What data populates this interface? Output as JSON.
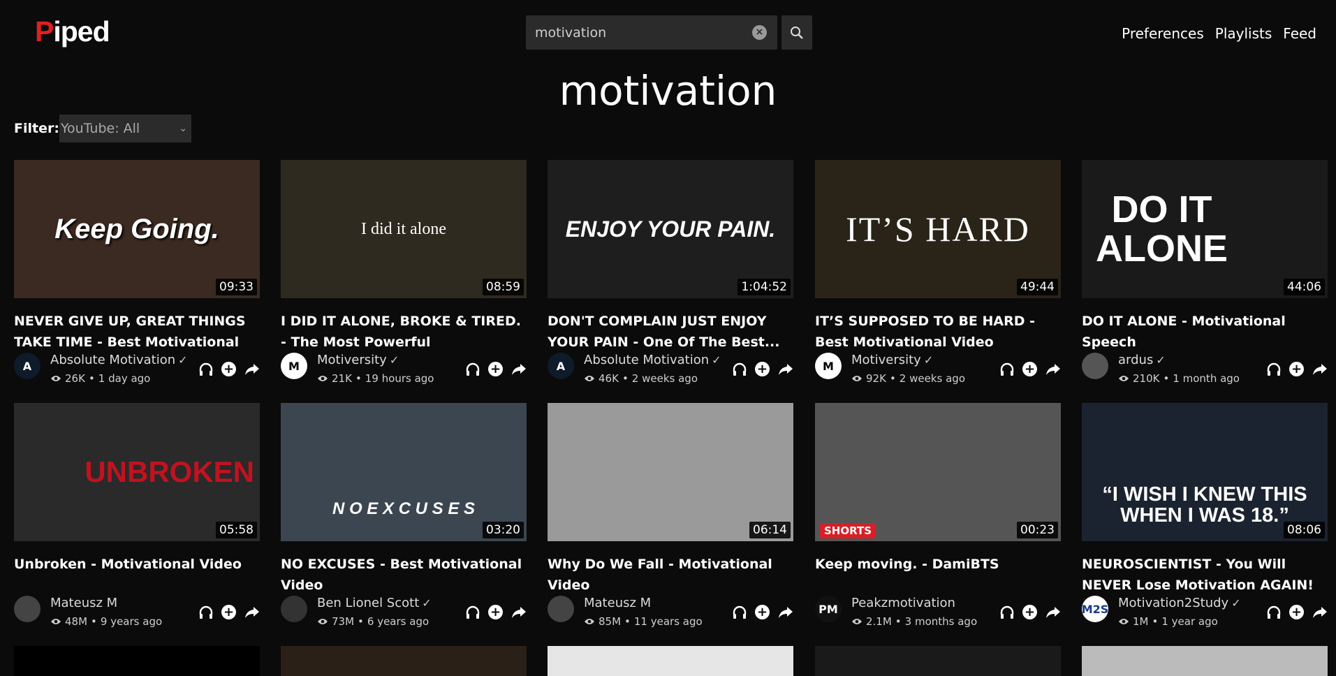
{
  "header": {
    "logo_initial": "P",
    "logo_rest": "iped",
    "search_value": "motivation",
    "nav": [
      "Preferences",
      "Playlists",
      "Feed"
    ]
  },
  "page_title": "motivation",
  "filter": {
    "label": "Filter:",
    "selected": "YouTube: All"
  },
  "videos": [
    {
      "title": "NEVER GIVE UP, GREAT THINGS TAKE TIME - Best Motivational Speech",
      "thumb_text": "Keep Going.",
      "duration": "09:33",
      "channel": "Absolute Motivation",
      "verified": true,
      "views": "26K",
      "age": "1 day ago",
      "thumb_color": "#3a2a22",
      "avatar_text": "A",
      "avatar_bg": "#0d1b2a",
      "avatar_fg": "#ffffff",
      "shorts": false
    },
    {
      "title": "I DID IT ALONE, BROKE & TIRED. - The Most Powerful Motivational...",
      "thumb_text": "I did it alone",
      "duration": "08:59",
      "channel": "Motiversity",
      "verified": true,
      "views": "21K",
      "age": "19 hours ago",
      "thumb_color": "#2e2a20",
      "avatar_text": "M",
      "avatar_bg": "#ffffff",
      "avatar_fg": "#000000",
      "shorts": false
    },
    {
      "title": "DON'T COMPLAIN JUST ENJOY YOUR PAIN - One Of The Best...",
      "thumb_text": "ENJOY YOUR PAIN.",
      "duration": "1:04:52",
      "channel": "Absolute Motivation",
      "verified": true,
      "views": "46K",
      "age": "2 weeks ago",
      "thumb_color": "#1e1e1e",
      "avatar_text": "A",
      "avatar_bg": "#0d1b2a",
      "avatar_fg": "#ffffff",
      "shorts": false
    },
    {
      "title": "IT’S SUPPOSED TO BE HARD - Best Motivational Video Speeches...",
      "thumb_text": "IT’S HARD",
      "duration": "49:44",
      "channel": "Motiversity",
      "verified": true,
      "views": "92K",
      "age": "2 weeks ago",
      "thumb_color": "#2a2418",
      "avatar_text": "M",
      "avatar_bg": "#ffffff",
      "avatar_fg": "#000000",
      "shorts": false
    },
    {
      "title": "DO IT ALONE - Motivational Speech",
      "thumb_text": "DO IT ALONE",
      "duration": "44:06",
      "channel": "ardus",
      "verified": true,
      "views": "210K",
      "age": "1 month ago",
      "thumb_color": "#1a1a1a",
      "avatar_text": "",
      "avatar_bg": "#555555",
      "avatar_fg": "#ffffff",
      "shorts": false
    },
    {
      "title": "Unbroken - Motivational Video",
      "thumb_text": "UNBROKEN",
      "duration": "05:58",
      "channel": "Mateusz M",
      "verified": false,
      "views": "48M",
      "age": "9 years ago",
      "thumb_color": "#2a2a2a",
      "avatar_text": "",
      "avatar_bg": "#444444",
      "avatar_fg": "#ffffff",
      "shorts": false
    },
    {
      "title": "NO EXCUSES - Best Motivational Video",
      "thumb_text": "N O   E X C U S E S",
      "duration": "03:20",
      "channel": "Ben Lionel Scott",
      "verified": true,
      "views": "73M",
      "age": "6 years ago",
      "thumb_color": "#3c4650",
      "avatar_text": "",
      "avatar_bg": "#333333",
      "avatar_fg": "#ffffff",
      "shorts": false
    },
    {
      "title": "Why Do We Fall - Motivational Video",
      "thumb_text": "",
      "duration": "06:14",
      "channel": "Mateusz M",
      "verified": false,
      "views": "85M",
      "age": "11 years ago",
      "thumb_color": "#9a9a9a",
      "avatar_text": "",
      "avatar_bg": "#444444",
      "avatar_fg": "#ffffff",
      "shorts": false
    },
    {
      "title": "Keep moving. - DamiBTS",
      "thumb_text": "",
      "duration": "00:23",
      "channel": "Peakzmotivation",
      "verified": false,
      "views": "2.1M",
      "age": "3 months ago",
      "thumb_color": "#555555",
      "avatar_text": "PM",
      "avatar_bg": "#111111",
      "avatar_fg": "#ffffff",
      "shorts": true,
      "shorts_label": "SHORTS"
    },
    {
      "title": "NEUROSCIENTIST - You Will NEVER Lose Motivation AGAIN!",
      "thumb_text": "“I WISH I KNEW THIS WHEN I WAS 18.”",
      "duration": "08:06",
      "channel": "Motivation2Study",
      "verified": true,
      "views": "1M",
      "age": "1 year ago",
      "thumb_color": "#1b2330",
      "avatar_text": "M2S",
      "avatar_bg": "#ffffff",
      "avatar_fg": "#1b3a8a",
      "shorts": false
    }
  ],
  "peek_colors": [
    "#000000",
    "#2a2018",
    "#e6e6e6",
    "#1a1a1a",
    "#bbbbbb"
  ]
}
